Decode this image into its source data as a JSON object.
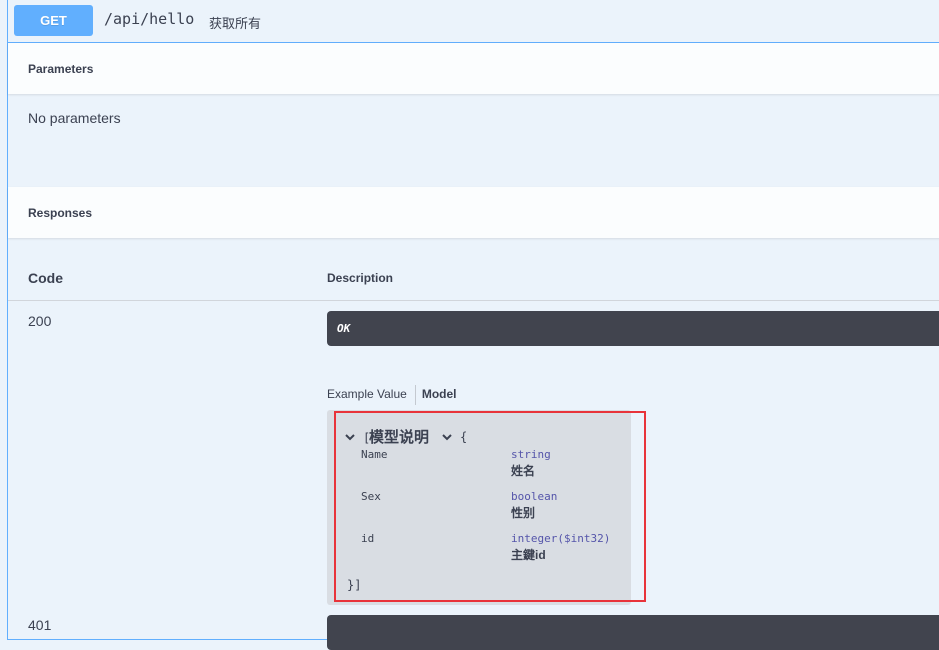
{
  "summary": {
    "method": "GET",
    "path": "/api/hello",
    "description": "获取所有"
  },
  "parameters": {
    "title": "Parameters",
    "empty_text": "No parameters"
  },
  "responses": {
    "title": "Responses",
    "col_code": "Code",
    "col_description": "Description",
    "rows": [
      {
        "code": "200",
        "description": "OK",
        "tabs": {
          "example": "Example Value",
          "model": "Model"
        },
        "model": {
          "open_bracket": "[",
          "title": "模型说明",
          "open_brace": "{",
          "properties": [
            {
              "name": "Name",
              "type": "string",
              "desc": "姓名"
            },
            {
              "name": "Sex",
              "type": "boolean",
              "desc": "性别"
            },
            {
              "name": "id",
              "type": "integer($int32)",
              "desc": "主鍵id"
            }
          ],
          "close": "}]"
        }
      },
      {
        "code": "401"
      }
    ]
  },
  "colors": {
    "get_blue": "#61affe",
    "background": "#ebf3fb",
    "dark_bar": "#41444e",
    "highlight_red": "#e8333a"
  }
}
